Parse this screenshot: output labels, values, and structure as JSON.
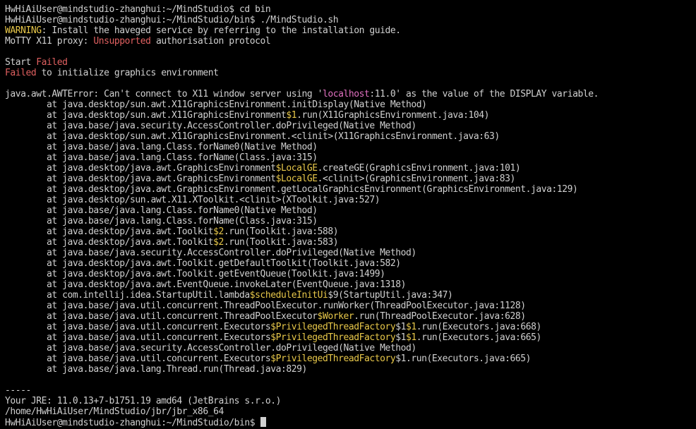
{
  "lines": [
    [
      {
        "t": "HwHiAiUser@mindstudio-zhanghui:~/MindStudio$ cd bin"
      }
    ],
    [
      {
        "t": "HwHiAiUser@mindstudio-zhanghui:~/MindStudio/bin$ ./MindStudio.sh"
      }
    ],
    [
      {
        "t": "WARNING",
        "c": "yellow"
      },
      {
        "t": ": Install the haveged service by referring to the installation guide."
      }
    ],
    [
      {
        "t": "MoTTY X11 proxy: "
      },
      {
        "t": "Unsupported",
        "c": "red"
      },
      {
        "t": " authorisation protocol"
      }
    ],
    [],
    [
      {
        "t": "Start "
      },
      {
        "t": "Failed",
        "c": "red"
      }
    ],
    [
      {
        "t": "Failed",
        "c": "red"
      },
      {
        "t": " to initialize graphics environment"
      }
    ],
    [],
    [
      {
        "t": "java.awt.AWTError: Can't connect to X11 window server using '"
      },
      {
        "t": "localhost",
        "c": "pink"
      },
      {
        "t": ":11.0' as the value of the DISPLAY variable."
      }
    ],
    [
      {
        "t": "        at java.desktop/sun.awt.X11GraphicsEnvironment.initDisplay(Native Method)"
      }
    ],
    [
      {
        "t": "        at java.desktop/sun.awt.X11GraphicsEnvironment"
      },
      {
        "t": "$1",
        "c": "yellow"
      },
      {
        "t": ".run(X11GraphicsEnvironment.java:104)"
      }
    ],
    [
      {
        "t": "        at java.base/java.security.AccessController.doPrivileged(Native Method)"
      }
    ],
    [
      {
        "t": "        at java.desktop/sun.awt.X11GraphicsEnvironment.<clinit>(X11GraphicsEnvironment.java:63)"
      }
    ],
    [
      {
        "t": "        at java.base/java.lang.Class.forName0(Native Method)"
      }
    ],
    [
      {
        "t": "        at java.base/java.lang.Class.forName(Class.java:315)"
      }
    ],
    [
      {
        "t": "        at java.desktop/java.awt.GraphicsEnvironment"
      },
      {
        "t": "$LocalGE",
        "c": "yellow"
      },
      {
        "t": ".createGE(GraphicsEnvironment.java:101)"
      }
    ],
    [
      {
        "t": "        at java.desktop/java.awt.GraphicsEnvironment"
      },
      {
        "t": "$LocalGE",
        "c": "yellow"
      },
      {
        "t": ".<clinit>(GraphicsEnvironment.java:83)"
      }
    ],
    [
      {
        "t": "        at java.desktop/java.awt.GraphicsEnvironment.getLocalGraphicsEnvironment(GraphicsEnvironment.java:129)"
      }
    ],
    [
      {
        "t": "        at java.desktop/sun.awt.X11.XToolkit.<clinit>(XToolkit.java:527)"
      }
    ],
    [
      {
        "t": "        at java.base/java.lang.Class.forName0(Native Method)"
      }
    ],
    [
      {
        "t": "        at java.base/java.lang.Class.forName(Class.java:315)"
      }
    ],
    [
      {
        "t": "        at java.desktop/java.awt.Toolkit"
      },
      {
        "t": "$2",
        "c": "yellow"
      },
      {
        "t": ".run(Toolkit.java:588)"
      }
    ],
    [
      {
        "t": "        at java.desktop/java.awt.Toolkit"
      },
      {
        "t": "$2",
        "c": "yellow"
      },
      {
        "t": ".run(Toolkit.java:583)"
      }
    ],
    [
      {
        "t": "        at java.base/java.security.AccessController.doPrivileged(Native Method)"
      }
    ],
    [
      {
        "t": "        at java.desktop/java.awt.Toolkit.getDefaultToolkit(Toolkit.java:582)"
      }
    ],
    [
      {
        "t": "        at java.desktop/java.awt.Toolkit.getEventQueue(Toolkit.java:1499)"
      }
    ],
    [
      {
        "t": "        at java.desktop/java.awt.EventQueue.invokeLater(EventQueue.java:1318)"
      }
    ],
    [
      {
        "t": "        at com.intellij.idea.StartupUtil.lambda"
      },
      {
        "t": "$scheduleInitUi",
        "c": "yellow"
      },
      {
        "t": "$9(StartupUtil.java:347)"
      }
    ],
    [
      {
        "t": "        at java.base/java.util.concurrent.ThreadPoolExecutor.runWorker(ThreadPoolExecutor.java:1128)"
      }
    ],
    [
      {
        "t": "        at java.base/java.util.concurrent.ThreadPoolExecutor"
      },
      {
        "t": "$Worker",
        "c": "yellow"
      },
      {
        "t": ".run(ThreadPoolExecutor.java:628)"
      }
    ],
    [
      {
        "t": "        at java.base/java.util.concurrent.Executors"
      },
      {
        "t": "$PrivilegedThreadFactory",
        "c": "yellow"
      },
      {
        "t": "$1"
      },
      {
        "t": "$1",
        "c": "yellow"
      },
      {
        "t": ".run(Executors.java:668)"
      }
    ],
    [
      {
        "t": "        at java.base/java.util.concurrent.Executors"
      },
      {
        "t": "$PrivilegedThreadFactory",
        "c": "yellow"
      },
      {
        "t": "$1"
      },
      {
        "t": "$1",
        "c": "yellow"
      },
      {
        "t": ".run(Executors.java:665)"
      }
    ],
    [
      {
        "t": "        at java.base/java.security.AccessController.doPrivileged(Native Method)"
      }
    ],
    [
      {
        "t": "        at java.base/java.util.concurrent.Executors"
      },
      {
        "t": "$PrivilegedThreadFactory",
        "c": "yellow"
      },
      {
        "t": "$1.run(Executors.java:665)"
      }
    ],
    [
      {
        "t": "        at java.base/java.lang.Thread.run(Thread.java:829)"
      }
    ],
    [],
    [
      {
        "t": "-----"
      }
    ],
    [
      {
        "t": "Your JRE: 11.0.13+7-b1751.19 amd64 (JetBrains s.r.o.)"
      }
    ],
    [
      {
        "t": "/home/HwHiAiUser/MindStudio/jbr/jbr_x86_64"
      }
    ],
    [
      {
        "t": "HwHiAiUser@mindstudio-zhanghui:~/MindStudio/bin$ "
      }
    ]
  ],
  "colors": {
    "background": "#000000",
    "text": "#d0d0d0",
    "yellow": "#e8c84a",
    "red": "#e06060",
    "pink": "#e070c0"
  }
}
